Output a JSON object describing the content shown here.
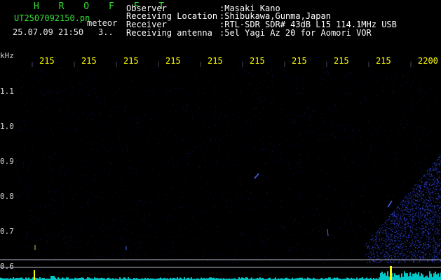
{
  "header": {
    "brand": "H R O F F T",
    "filename": "UT2507092150.pn",
    "filename_suffix": "meteor",
    "datetime": "25.07.09 21:50",
    "count": "3.."
  },
  "meta": {
    "observer_label": "Observer",
    "observer_value": ":Masaki Kano",
    "location_label": "Receiving Location",
    "location_value": ":Shibukawa,Gunma,Japan",
    "receiver_label": "Receiver",
    "receiver_value": ":RTL-SDR SDR# 43dB L15 114.1MHz USB",
    "antenna_label": "Receiving antenna",
    "antenna_value": ":5el Yagi Az 20 for Aomori VOR"
  },
  "axes": {
    "y_unit": "kHz",
    "y_ticks": [
      "1.1",
      "1.0",
      "0.9",
      "0.8",
      "0.7",
      "0.6"
    ],
    "x_ticks": [
      "215",
      "215",
      "215",
      "215",
      "215",
      "215",
      "215",
      "215",
      "215",
      "2200"
    ]
  },
  "colors": {
    "background": "#000000",
    "signal": "#3355ff",
    "tick_text": "#ffff00",
    "header_green": "#33dd33",
    "baseline": "#00c8c8"
  }
}
